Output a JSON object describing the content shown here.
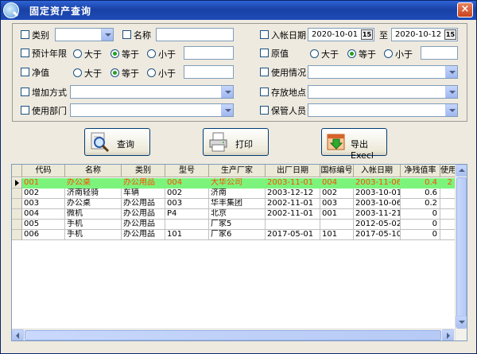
{
  "window": {
    "title": "固定资产查询",
    "close_label": "×"
  },
  "filters": {
    "category_label": "类别",
    "category_value": "",
    "name_label": "名称",
    "name_value": "",
    "entry_date_label": "入帐日期",
    "entry_date_from": "2020-10-01",
    "entry_date_to_label": "至",
    "entry_date_to": "2020-10-12",
    "calendar_glyph": "15",
    "life_label": "预计年限",
    "original_label": "原值",
    "net_label": "净值",
    "gt_label": "大于",
    "eq_label": "等于",
    "lt_label": "小于",
    "usage_label": "使用情况",
    "add_method_label": "增加方式",
    "location_label": "存放地点",
    "department_label": "使用部门",
    "keeper_label": "保管人员"
  },
  "buttons": {
    "query": "查询",
    "print": "打印",
    "export": "导出Execl"
  },
  "grid": {
    "columns": [
      "代码",
      "名称",
      "类别",
      "型号",
      "生产厂家",
      "出厂日期",
      "国标编号",
      "入帐日期",
      "净残值率",
      "使用"
    ],
    "rows": [
      [
        "001",
        "办公桌",
        "办公用品",
        "004",
        "大华公司",
        "2003-11-01",
        "004",
        "2003-11-06",
        "0.4",
        "2"
      ],
      [
        "002",
        "济南轻骑",
        "车辆",
        "002",
        "济南",
        "2003-12-12",
        "002",
        "2003-10-01",
        "0.6",
        ""
      ],
      [
        "003",
        "办公桌",
        "办公用品",
        "003",
        "华丰集团",
        "2002-11-01",
        "003",
        "2003-10-06",
        "0.2",
        ""
      ],
      [
        "004",
        "微机",
        "办公用品",
        "P4",
        "北京",
        "2002-11-01",
        "001",
        "2003-11-21",
        "0",
        ""
      ],
      [
        "005",
        "手机",
        "办公用品",
        "",
        "厂家5",
        "",
        "",
        "2012-05-02",
        "0",
        ""
      ],
      [
        "006",
        "手机",
        "办公用品",
        "101",
        "厂家6",
        "2017-05-01",
        "101",
        "2017-05-10",
        "0",
        ""
      ]
    ],
    "selected_row": 0
  },
  "colors": {
    "selected_row_bg": "#7cf47c",
    "selected_row_fg": "#ff4b00",
    "title_bar": "#1941a5"
  }
}
